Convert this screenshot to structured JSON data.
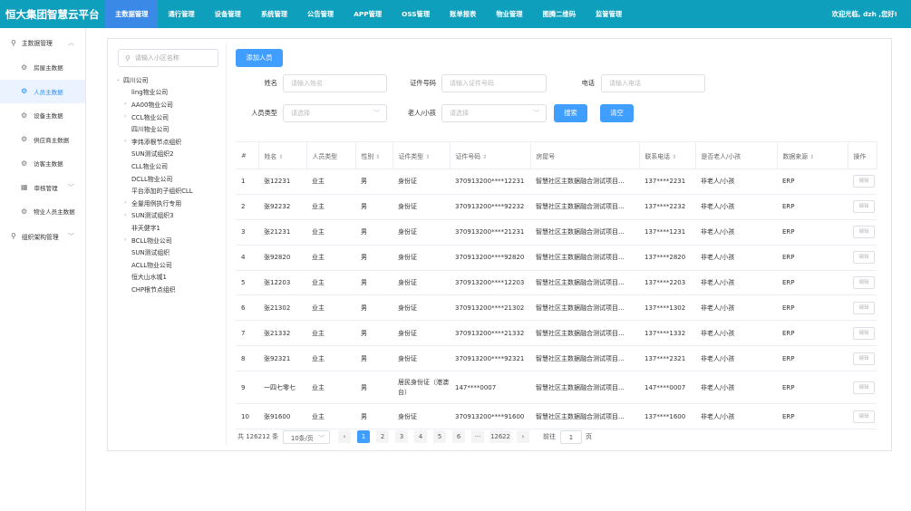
{
  "header": {
    "brand": "恒大集团智慧云平台",
    "nav": [
      "主数据管理",
      "通行管理",
      "设备管理",
      "系统管理",
      "公告管理",
      "APP管理",
      "OSS管理",
      "账单报表",
      "物业管理",
      "图腾二维码",
      "监管管理"
    ],
    "active_nav": 0,
    "welcome": "欢迎光临, dzh ,您好!"
  },
  "sidebar": {
    "group_main": "主数据管理",
    "items": [
      "房屋主数据",
      "人员主数据",
      "设备主数据",
      "供应商主数据",
      "访客主数据"
    ],
    "audit": "审核管理",
    "property_people": "物业人员主数据",
    "org": "组织架构管理"
  },
  "tree": {
    "search_placeholder": "请输入小区名称",
    "nodes": [
      {
        "label": "四川公司",
        "level": 0,
        "toggle": "⌄"
      },
      {
        "label": "ling物业公司",
        "level": 1,
        "toggle": ""
      },
      {
        "label": "AA00物业公司",
        "level": 1,
        "toggle": "›"
      },
      {
        "label": "CCL物业公司",
        "level": 1,
        "toggle": "›"
      },
      {
        "label": "四川物业公司",
        "level": 1,
        "toggle": ""
      },
      {
        "label": "李炜添根节点组织",
        "level": 1,
        "toggle": "›"
      },
      {
        "label": "SUN测试组织2",
        "level": 1,
        "toggle": ""
      },
      {
        "label": "CLL物业公司",
        "level": 1,
        "toggle": ""
      },
      {
        "label": "DCLL物业公司",
        "level": 1,
        "toggle": ""
      },
      {
        "label": "平台添加的子组织CLL",
        "level": 1,
        "toggle": ""
      },
      {
        "label": "全量用例执行专用",
        "level": 1,
        "toggle": "›"
      },
      {
        "label": "SUN测试组织3",
        "level": 1,
        "toggle": "›"
      },
      {
        "label": "非天健字1",
        "level": 1,
        "toggle": ""
      },
      {
        "label": "BCLL物业公司",
        "level": 1,
        "toggle": "›"
      },
      {
        "label": "SUN测试组织",
        "level": 1,
        "toggle": ""
      },
      {
        "label": "ACLL物业公司",
        "level": 1,
        "toggle": ""
      },
      {
        "label": "恒大山水城1",
        "level": 1,
        "toggle": ""
      },
      {
        "label": "CHP根节点组织",
        "level": 1,
        "toggle": ""
      }
    ]
  },
  "form": {
    "add_button": "添加人员",
    "name_label": "姓名",
    "name_placeholder": "请输入姓名",
    "id_label": "证件号码",
    "id_placeholder": "请输入证件号码",
    "phone_label": "电话",
    "phone_placeholder": "请输入电话",
    "type_label": "人员类型",
    "type_placeholder": "请选择",
    "age_label": "老人/小孩",
    "age_placeholder": "请选择",
    "search_button": "搜索",
    "clear_button": "清空"
  },
  "table": {
    "columns": [
      "#",
      "姓名",
      "人员类型",
      "性别",
      "证件类型",
      "证件号码",
      "房屋号",
      "联系电话",
      "是否老人/小孩",
      "数据来源",
      "操作"
    ],
    "sortable": [
      false,
      true,
      false,
      true,
      true,
      true,
      false,
      true,
      false,
      true,
      false
    ],
    "edit_label": "编辑",
    "rows": [
      [
        "1",
        "张12231",
        "业主",
        "男",
        "身份证",
        "370913200****12231",
        "智慧社区主数据融合测试项目...",
        "137****2231",
        "非老人/小孩",
        "ERP"
      ],
      [
        "2",
        "张92232",
        "业主",
        "男",
        "身份证",
        "370913200****92232",
        "智慧社区主数据融合测试项目...",
        "137****2232",
        "非老人/小孩",
        "ERP"
      ],
      [
        "3",
        "张21231",
        "业主",
        "男",
        "身份证",
        "370913200****21231",
        "智慧社区主数据融合测试项目...",
        "137****1231",
        "非老人/小孩",
        "ERP"
      ],
      [
        "4",
        "张92820",
        "业主",
        "男",
        "身份证",
        "370913200****92820",
        "智慧社区主数据融合测试项目...",
        "137****2820",
        "非老人/小孩",
        "ERP"
      ],
      [
        "5",
        "张12203",
        "业主",
        "男",
        "身份证",
        "370913200****12203",
        "智慧社区主数据融合测试项目...",
        "137****2203",
        "非老人/小孩",
        "ERP"
      ],
      [
        "6",
        "张21302",
        "业主",
        "男",
        "身份证",
        "370913200****21302",
        "智慧社区主数据融合测试项目...",
        "137****1302",
        "非老人/小孩",
        "ERP"
      ],
      [
        "7",
        "张21332",
        "业主",
        "男",
        "身份证",
        "370913200****21332",
        "智慧社区主数据融合测试项目...",
        "137****1332",
        "非老人/小孩",
        "ERP"
      ],
      [
        "8",
        "张92321",
        "业主",
        "男",
        "身份证",
        "370913200****92321",
        "智慧社区主数据融合测试项目...",
        "137****2321",
        "非老人/小孩",
        "ERP"
      ],
      [
        "9",
        "一四七零七",
        "业主",
        "男",
        "居民身份证（港澳台）",
        "147****0007",
        "智慧社区主数据融合测试项目...",
        "147****0007",
        "非老人/小孩",
        "ERP"
      ],
      [
        "10",
        "张91600",
        "业主",
        "男",
        "身份证",
        "370913200****91600",
        "智慧社区主数据融合测试项目...",
        "137****1600",
        "非老人/小孩",
        "ERP"
      ]
    ]
  },
  "pagination": {
    "total": "共 126212 条",
    "page_size": "10条/页",
    "prev": "‹",
    "next": "›",
    "pages": [
      "1",
      "2",
      "3",
      "4",
      "5",
      "6",
      "···",
      "12622"
    ],
    "current": "1",
    "goto_label": "前往",
    "goto_value": "1",
    "page_unit": "页"
  },
  "colors": {
    "header": "#0e9fbd",
    "active_nav": "#3b89e6",
    "primary": "#409eff"
  }
}
